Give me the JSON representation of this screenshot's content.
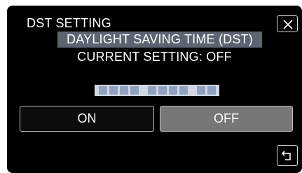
{
  "header": {
    "title": "DST SETTING"
  },
  "dialog": {
    "highlight": "DAYLIGHT SAVING TIME (DST)",
    "current_setting": "CURRENT SETTING: OFF"
  },
  "options": {
    "on_label": "ON",
    "off_label": "OFF",
    "selected": "OFF"
  },
  "icons": {
    "close": "close-icon",
    "back": "back-arrow-icon"
  },
  "colors": {
    "background": "#000000",
    "highlight_bg": "#5b6470",
    "selected_button_bg": "#777777",
    "placeholder_bar": "#cfd8e6"
  }
}
